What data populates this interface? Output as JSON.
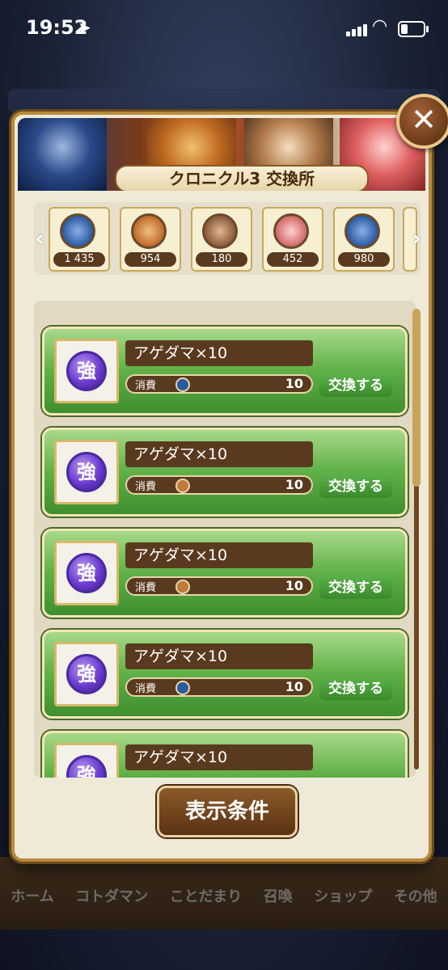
{
  "status": {
    "time": "19:52",
    "location_icon": "location-arrow-icon"
  },
  "dialog": {
    "title": "クロニクル3 交換所",
    "close_icon": "close-icon",
    "filter_button": "表示条件"
  },
  "currencies": [
    {
      "count": "1 435",
      "color": "#2a5aa0"
    },
    {
      "count": "954",
      "color": "#c06a2a"
    },
    {
      "count": "180",
      "color": "#8a5a3a"
    },
    {
      "count": "452",
      "color": "#d06a6a"
    },
    {
      "count": "980",
      "color": "#2a5aa0"
    }
  ],
  "items": [
    {
      "name": "アゲダマ×10",
      "cost_label": "消費",
      "cost": "10",
      "button": "交換する",
      "badge": "強",
      "cost_color": "#2a5aa0"
    },
    {
      "name": "アゲダマ×10",
      "cost_label": "消費",
      "cost": "10",
      "button": "交換する",
      "badge": "強",
      "cost_color": "#c07a3a"
    },
    {
      "name": "アゲダマ×10",
      "cost_label": "消費",
      "cost": "10",
      "button": "交換する",
      "badge": "強",
      "cost_color": "#c07a3a"
    },
    {
      "name": "アゲダマ×10",
      "cost_label": "消費",
      "cost": "10",
      "button": "交換する",
      "badge": "強",
      "cost_color": "#2a5aa0"
    },
    {
      "name": "アゲダマ×10",
      "cost_label": "",
      "cost": "",
      "button": "",
      "badge": "強",
      "cost_color": "#2a5aa0"
    }
  ],
  "bottom_nav": [
    "ホーム",
    "コトダマン",
    "ことだまり",
    "召喚",
    "ショップ",
    "その他"
  ]
}
